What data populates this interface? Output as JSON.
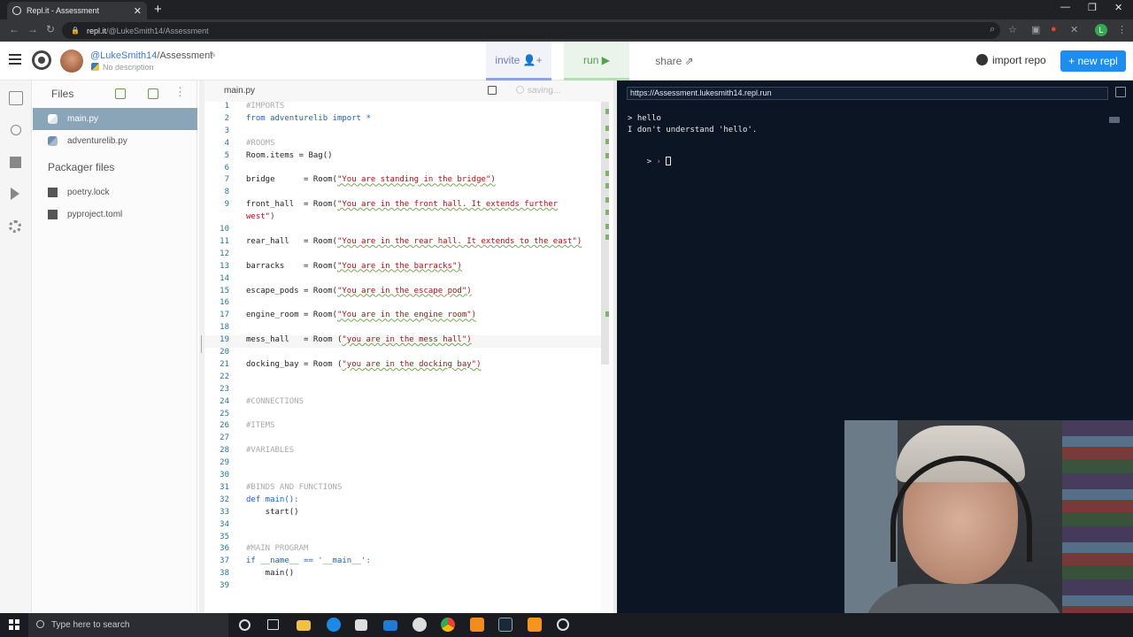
{
  "browser": {
    "tab_title": "Repl.it - Assessment",
    "tab_close": "✕",
    "new_tab": "+",
    "url_host": "repl.it",
    "url_path": "/@LukeSmith14/Assessment",
    "win_min": "—",
    "win_max": "❐",
    "win_close": "✕",
    "profile_initial": "L"
  },
  "header": {
    "user": "@LukeSmith14",
    "separator": "/",
    "repl_name": "Assessment",
    "description": "No description",
    "invite_label": "invite",
    "invite_icon": "👤+",
    "run_label": "run",
    "run_icon": "▶",
    "share_label": "share",
    "share_icon": "⇗",
    "import_label": "import repo",
    "new_repl_label": "+ new repl"
  },
  "files": {
    "title": "Files",
    "items": [
      "main.py",
      "adventurelib.py"
    ],
    "active": "main.py",
    "packager_title": "Packager files",
    "packager_items": [
      "poetry.lock",
      "pyproject.toml"
    ]
  },
  "editor": {
    "tab": "main.py",
    "status": "saving...",
    "current_line": 19,
    "lines": [
      {
        "n": "1",
        "t": "#IMPORTS",
        "c": "cm"
      },
      {
        "n": "2",
        "t": "from adventurelib import *",
        "c": "kw"
      },
      {
        "n": "3",
        "t": "",
        "c": "nm"
      },
      {
        "n": "4",
        "t": "#ROOMS",
        "c": "cm"
      },
      {
        "n": "5",
        "t": "Room.items = Bag()",
        "c": "nm"
      },
      {
        "n": "6",
        "t": "",
        "c": "nm"
      },
      {
        "n": "7",
        "t": "bridge      = Room(\"You are standing in the bridge\")",
        "c": "nm"
      },
      {
        "n": "8",
        "t": "",
        "c": "nm"
      },
      {
        "n": "9",
        "t": "front_hall  = Room(\"You are in the front hall. It extends further",
        "c": "nm"
      },
      {
        "n": "",
        "t": "west\")",
        "c": "st"
      },
      {
        "n": "10",
        "t": "",
        "c": "nm"
      },
      {
        "n": "11",
        "t": "rear_hall   = Room(\"You are in the rear hall. It extends to the east\")",
        "c": "nm"
      },
      {
        "n": "12",
        "t": "",
        "c": "nm"
      },
      {
        "n": "13",
        "t": "barracks    = Room(\"You are in the barracks\")",
        "c": "nm"
      },
      {
        "n": "14",
        "t": "",
        "c": "nm"
      },
      {
        "n": "15",
        "t": "escape_pods = Room(\"You are in the escape pod\")",
        "c": "nm"
      },
      {
        "n": "16",
        "t": "",
        "c": "nm"
      },
      {
        "n": "17",
        "t": "engine_room = Room(\"You are in the engine room\")",
        "c": "nm"
      },
      {
        "n": "18",
        "t": "",
        "c": "nm"
      },
      {
        "n": "19",
        "t": "mess_hall   = Room (\"you are in the mess hall\")",
        "c": "nm"
      },
      {
        "n": "20",
        "t": "",
        "c": "nm"
      },
      {
        "n": "21",
        "t": "docking_bay = Room (\"you are in the docking bay\")",
        "c": "nm"
      },
      {
        "n": "22",
        "t": "",
        "c": "nm"
      },
      {
        "n": "23",
        "t": "",
        "c": "nm"
      },
      {
        "n": "24",
        "t": "#CONNECTIONS",
        "c": "cm"
      },
      {
        "n": "25",
        "t": "",
        "c": "nm"
      },
      {
        "n": "26",
        "t": "#ITEMS",
        "c": "cm"
      },
      {
        "n": "27",
        "t": "",
        "c": "nm"
      },
      {
        "n": "28",
        "t": "#VARIABLES",
        "c": "cm"
      },
      {
        "n": "29",
        "t": "",
        "c": "nm"
      },
      {
        "n": "30",
        "t": "",
        "c": "nm"
      },
      {
        "n": "31",
        "t": "#BINDS AND FUNCTIONS",
        "c": "cm"
      },
      {
        "n": "32",
        "t": "def main():",
        "c": "kw"
      },
      {
        "n": "33",
        "t": "    start()",
        "c": "nm"
      },
      {
        "n": "34",
        "t": "",
        "c": "nm"
      },
      {
        "n": "35",
        "t": "",
        "c": "nm"
      },
      {
        "n": "36",
        "t": "#MAIN PROGRAM",
        "c": "cm"
      },
      {
        "n": "37",
        "t": "if __name__ == '__main__':",
        "c": "kw"
      },
      {
        "n": "38",
        "t": "    main()",
        "c": "nm"
      },
      {
        "n": "39",
        "t": "",
        "c": "nm"
      }
    ]
  },
  "console": {
    "url": "https://Assessment.lukesmith14.repl.run",
    "lines": [
      "> hello",
      "I don't understand 'hello'."
    ],
    "prompt": ">",
    "prompt_arrow": "›"
  },
  "taskbar": {
    "search_placeholder": "Type here to search"
  },
  "colors": {
    "accent_blue": "#1f8ded",
    "console_bg": "#0c1524",
    "active_file_bg": "#8aa4b8",
    "run_green": "#4ea24e"
  }
}
